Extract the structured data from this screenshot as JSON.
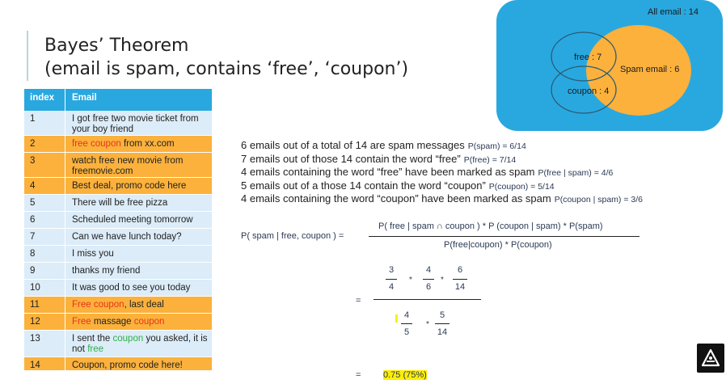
{
  "title": {
    "line1": "Bayes’ Theorem",
    "line2": "(email is spam, contains ‘free’, ‘coupon’)"
  },
  "table": {
    "headers": [
      "index",
      "Email"
    ],
    "rows": [
      {
        "index": "1",
        "text": "I got free two movie ticket from your boy friend",
        "spam": false
      },
      {
        "index": "2",
        "spam": true
      },
      {
        "index": "3",
        "text": "watch free new movie from freemovie.com",
        "spam": true
      },
      {
        "index": "4",
        "text": "Best deal, promo code here",
        "spam": true
      },
      {
        "index": "5",
        "text": "There will be free pizza",
        "spam": false
      },
      {
        "index": "6",
        "text": "Scheduled meeting tomorrow",
        "spam": false
      },
      {
        "index": "7",
        "text": "Can we have lunch today?",
        "spam": false
      },
      {
        "index": "8",
        "text": "I miss you",
        "spam": false
      },
      {
        "index": "9",
        "text": "thanks my friend",
        "spam": false
      },
      {
        "index": "10",
        "text": "It was good to see you today",
        "spam": false
      },
      {
        "index": "11",
        "spam": true
      },
      {
        "index": "12",
        "spam": true
      },
      {
        "index": "13",
        "spam": false
      },
      {
        "index": "14",
        "text": "Coupon, promo code here!",
        "spam": true
      }
    ],
    "row2": {
      "part1": "free coupon",
      "part2": " from xx.com"
    },
    "row11": {
      "part1": "Free coupon",
      "part2": ", last deal"
    },
    "row12": {
      "part1": "Free",
      "part2": " massage ",
      "part3": "coupon"
    },
    "row13": {
      "part1": "I sent the ",
      "part2": "coupon",
      "part3": " you asked, it is not ",
      "part4": "free"
    }
  },
  "venn": {
    "all": "All email : 14",
    "free": "free : 7",
    "coupon": "coupon : 4",
    "spam": "Spam email : 6",
    "colors": {
      "all": "#29a8e0",
      "spam": "#fbb13c",
      "outline": "#2b5a75"
    }
  },
  "statements": [
    {
      "text": "6 emails out of a total of 14 are spam messages",
      "prob": "P(spam) = 6/14"
    },
    {
      "text": "7 emails out of those 14 contain the word “free”",
      "prob": "P(free) = 7/14"
    },
    {
      "text": "4 emails containing the word “free” have been marked as spam",
      "prob": "P(free | spam) = 4/6"
    },
    {
      "text": "5 emails out of a those 14 contain the word “coupon”",
      "prob": "P(coupon) = 5/14"
    },
    {
      "text": "4 emails containing the word “coupon” have been marked as spam",
      "prob": "P(coupon | spam) = 3/6"
    }
  ],
  "formula": {
    "lhs": "P( spam | free, coupon ) =",
    "numerator": "P( free | spam ∩ coupon ) * P (coupon | spam) * P(spam)",
    "denominator": "P(free|coupon) * P(coupon)",
    "eq": "=",
    "f1": {
      "n": "3",
      "d": "4"
    },
    "f2": {
      "n": "4",
      "d": "6"
    },
    "f3": {
      "n": "6",
      "d": "14"
    },
    "f4": {
      "n": "4",
      "d": "5"
    },
    "f5": {
      "n": "5",
      "d": "14"
    },
    "times": "*",
    "result": "0.75 (75%)"
  }
}
